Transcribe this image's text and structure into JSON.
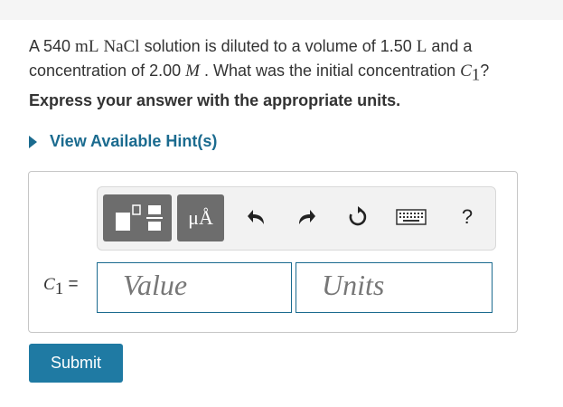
{
  "question": {
    "p1": "A 540 ",
    "u1": "mL",
    "chem": "NaCl",
    "p2": " solution is diluted to a volume of 1.50 ",
    "u2": "L",
    "p3": " and a concentration of 2.00 ",
    "u3": "M",
    "p4": " . What was the initial concentration ",
    "var": "C",
    "var_sub": "1",
    "p5": "?"
  },
  "instruction": "Express your answer with the appropriate units.",
  "hint_link": "View Available Hint(s)",
  "toolbar": {
    "templates_icon": "templates-icon",
    "units_label": "μÅ",
    "undo_icon": "undo-icon",
    "redo_icon": "redo-icon",
    "reset_icon": "reset-icon",
    "keyboard_icon": "keyboard-icon",
    "help_label": "?"
  },
  "answer": {
    "label_var": "C",
    "label_sub": "1",
    "label_eq": " =",
    "value_placeholder": "Value",
    "units_placeholder": "Units"
  },
  "submit_label": "Submit",
  "colors": {
    "accent": "#1b6b8f",
    "button": "#1f7aa3",
    "tool_bg": "#6d6d6d"
  }
}
